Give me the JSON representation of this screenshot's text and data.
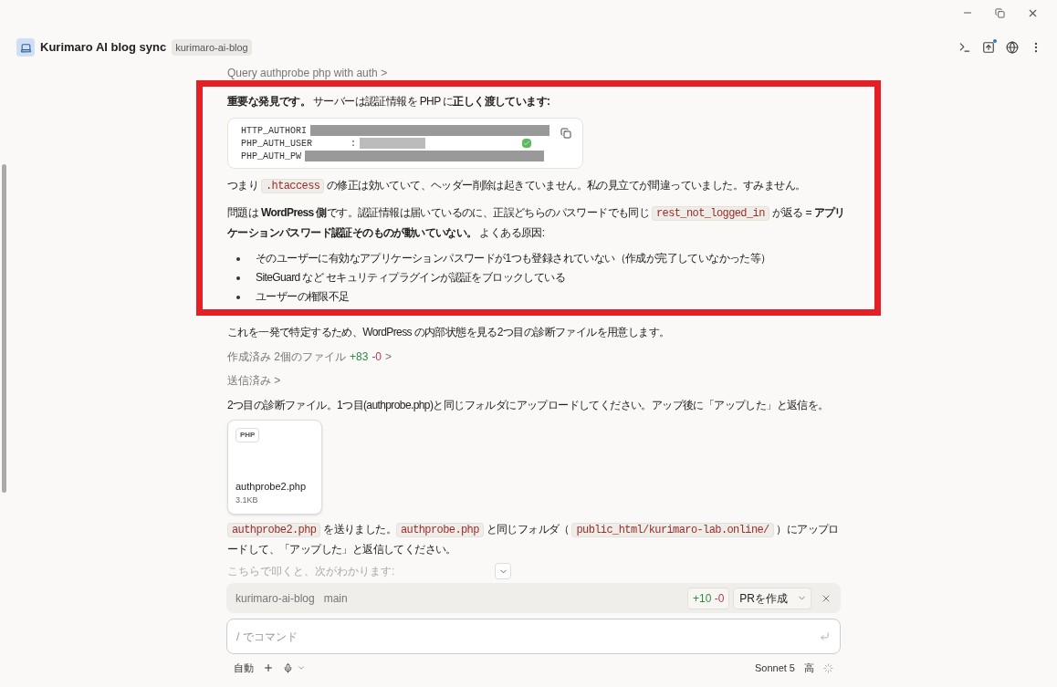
{
  "header": {
    "title": "Kurimaro AI blog sync",
    "repo_badge": "kurimaro-ai-blog"
  },
  "tool_step": {
    "label": "Query authprobe php with auth",
    "chevron": ">"
  },
  "highlighted": {
    "intro": "**重要な発見です。** サーバーは認証情報を PHP に**正しく渡しています:**",
    "code_lines": [
      {
        "text": "HTTP_AUTHORI",
        "kind": "long",
        "check": false
      },
      {
        "text": "PHP_AUTH_USER       :",
        "kind": "short",
        "check": true
      },
      {
        "text": "PHP_AUTH_PW",
        "kind": "long",
        "check": false
      }
    ],
    "paragraphs": [
      [
        {
          "kind": "text",
          "text": "つまり "
        },
        {
          "kind": "code",
          "text": ".htaccess"
        },
        {
          "kind": "text",
          "text": " の修正は効いていて、ヘッダー削除は起きていません。私の見立てが間違っていました。すみません。"
        }
      ],
      [
        {
          "kind": "text",
          "text": "問題は **WordPress 側**です。認証情報は届いているのに、正誤どちらのパスワードでも同じ "
        },
        {
          "kind": "code",
          "text": "rest_not_logged_in"
        },
        {
          "kind": "text",
          "text": " が返る = **アプリケーションパスワード認証そのものが動いていない。** よくある原因:"
        }
      ]
    ],
    "bullets": [
      "そのユーザーに有効なアプリケーションパスワードが1つも登録されていない（作成が完了していなかった等）",
      "SiteGuard など セキュリティプラグインが認証をブロックしている",
      "ユーザーの権限不足"
    ]
  },
  "after_text": "これを一発で特定するため、WordPress の内部状態を見る2つ目の診断ファイルを用意します。",
  "created_files": {
    "label": "作成済み 2個のファイル",
    "added": "+83",
    "removed": "-0",
    "chevron": ">"
  },
  "sent": {
    "label": "送信済み",
    "chevron": ">"
  },
  "message": "2つ目の診断ファイル。1つ目(authprobe.php)と同じフォルダにアップロードしてください。アップ後に「アップした」と返信を。",
  "attachment": {
    "type_badge": "PHP",
    "name": "authprobe2.php",
    "size": "3.1KB"
  },
  "final_paragraph": [
    {
      "kind": "code",
      "text": "authprobe2.php"
    },
    {
      "kind": "text",
      "text": " を送りました。"
    },
    {
      "kind": "code",
      "text": "authprobe.php"
    },
    {
      "kind": "text",
      "text": " と同じフォルダ（ "
    },
    {
      "kind": "code",
      "text": "public_html/kurimaro-lab.online/"
    },
    {
      "kind": "text",
      "text": " ）にアップロードして、「アップした」と返信してください。"
    }
  ],
  "faded_hint": "こちらで叩くと、次がわかります:",
  "branch_bar": {
    "repo": "kurimaro-ai-blog",
    "branch": "main",
    "added": "+10",
    "removed": "-0",
    "pr_button": "PRを作成"
  },
  "composer": {
    "placeholder": "/ でコマンド"
  },
  "footer": {
    "mode": "自動",
    "model": "Sonnet 5",
    "effort": "高"
  }
}
